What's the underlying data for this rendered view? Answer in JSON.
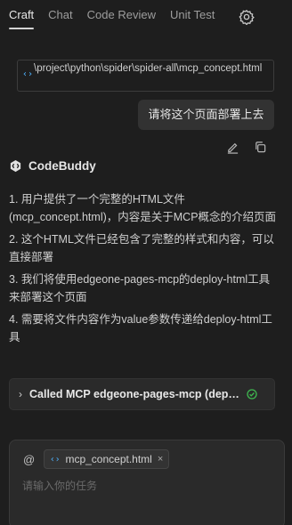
{
  "tabs": [
    {
      "label": "Craft",
      "active": true
    },
    {
      "label": "Chat",
      "active": false
    },
    {
      "label": "Code Review",
      "active": false
    },
    {
      "label": "Unit Test",
      "active": false
    }
  ],
  "settings_icon": "gear-icon",
  "attached_file": {
    "icon": "code-icon",
    "path": "\\project\\python\\spider\\spider-all\\mcp_concept.html"
  },
  "user_message": "请将这个页面部署上去",
  "message_tools": [
    "edit-icon",
    "copy-icon"
  ],
  "assistant": {
    "name": "CodeBuddy",
    "steps": [
      "1. 用户提供了一个完整的HTML文件(mcp_concept.html)，内容是关于MCP概念的介绍页面",
      "2. 这个HTML文件已经包含了完整的样式和内容，可以直接部署",
      "3. 我们将使用edgeone-pages-mcp的deploy-html工具来部署这个页面",
      "4. 需要将文件内容作为value参数传递给deploy-html工具"
    ],
    "tool_call": {
      "label": "Called MCP edgeone-pages-mcp (deploy-html)",
      "status_icon": "check-circle-icon",
      "status_color": "#3fb950"
    }
  },
  "composer": {
    "at_symbol": "@",
    "context_chip": {
      "icon": "code-icon",
      "name": "mcp_concept.html",
      "remove": "×"
    },
    "placeholder": "请输入你的任务"
  },
  "colors": {
    "background": "#1e1e1e",
    "accent": "#4fb3ff",
    "success": "#3fb950"
  }
}
